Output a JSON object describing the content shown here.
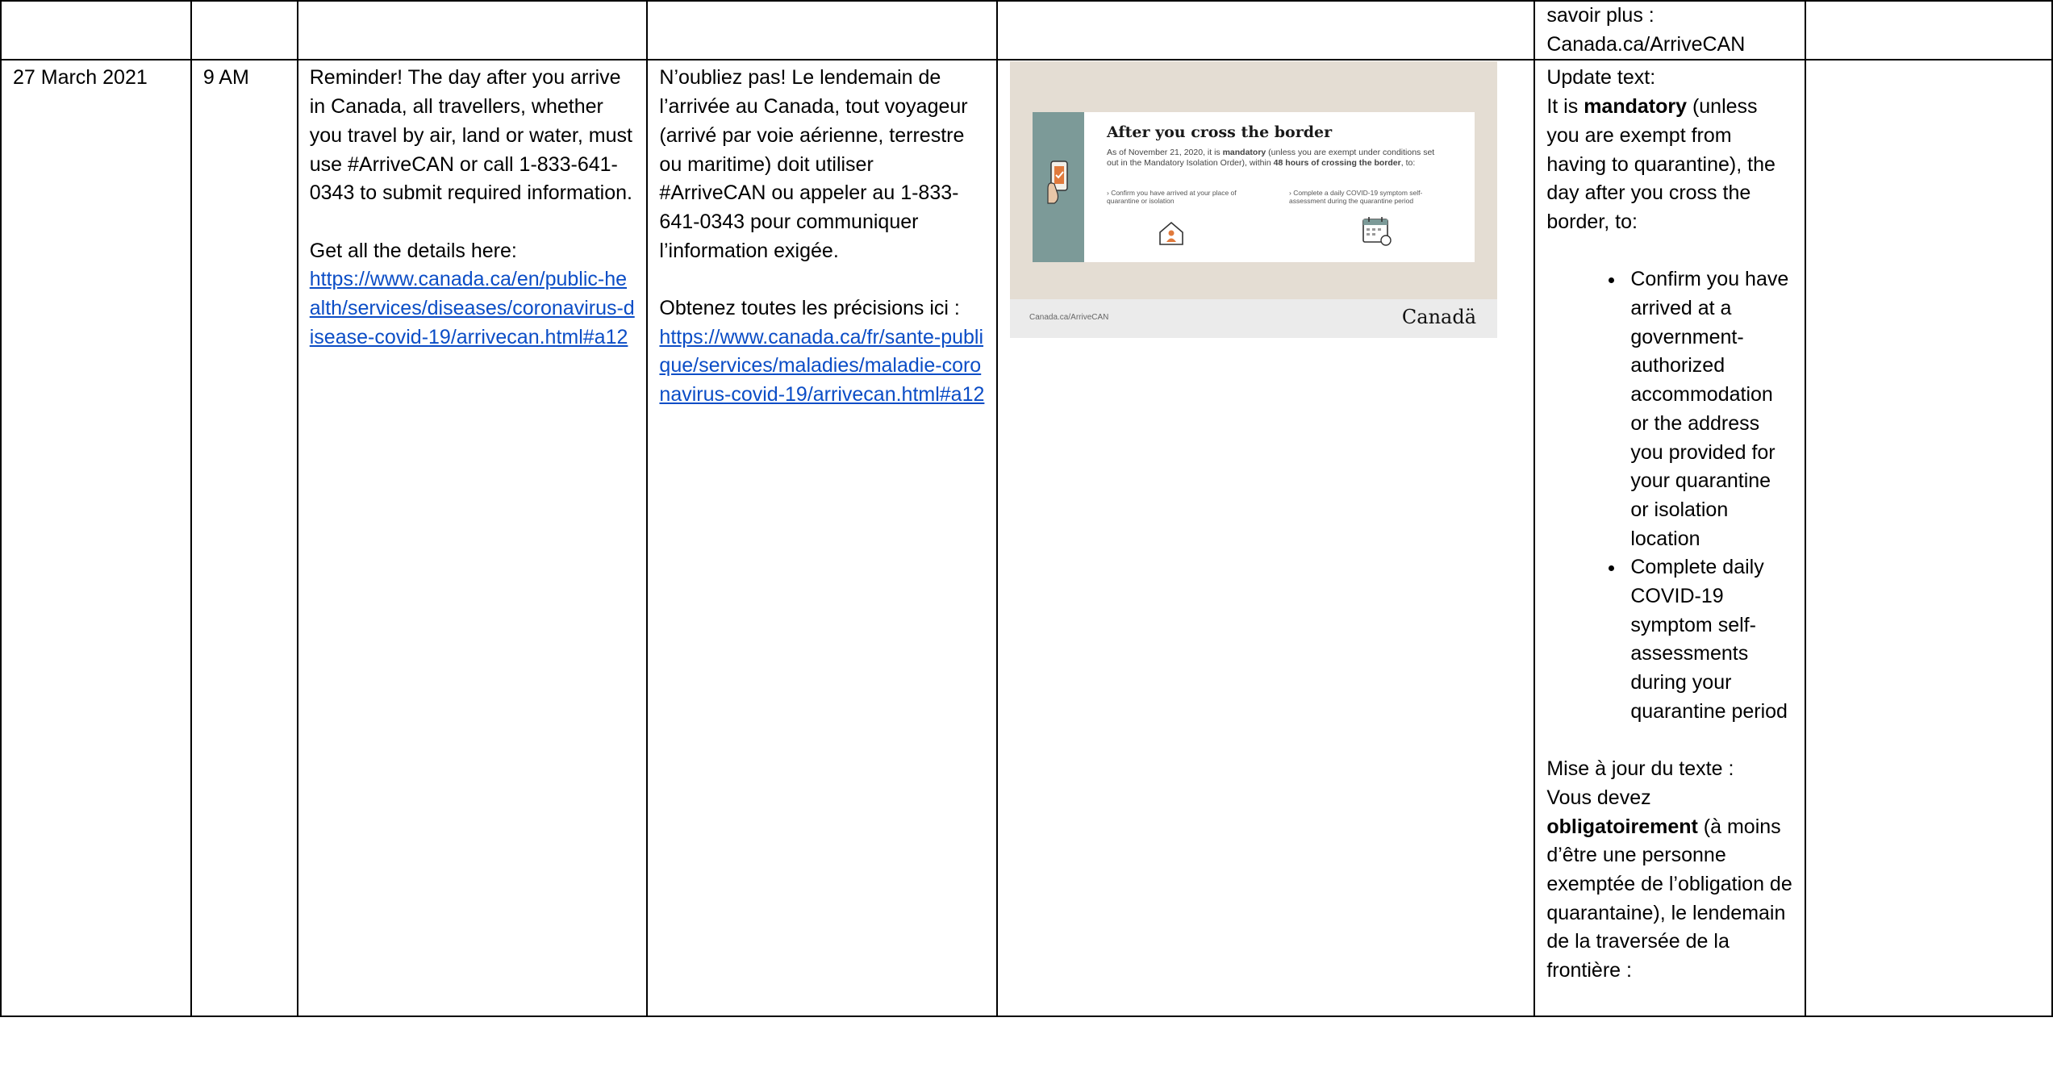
{
  "row0": {
    "col6": "savoir plus : Canada.ca/ArriveCAN"
  },
  "row1": {
    "date": "27 March 2021",
    "time": "9 AM",
    "english": {
      "body": "Reminder! The day after you arrive in Canada, all travellers, whether you travel by air, land or water, must use #ArriveCAN or call 1-833-641-0343 to submit required information.",
      "details_label": "Get all the details here:",
      "link": "https://www.canada.ca/en/public-health/services/diseases/coronavirus-disease-covid-19/arrivecan.html#a12"
    },
    "french": {
      "body": "N’oubliez pas! Le lendemain de l’arrivée au Canada, tout voyageur (arrivé par voie aérienne, terrestre ou maritime) doit utiliser #ArriveCAN ou appeler au 1-833-641-0343 pour communiquer l’information exigée.",
      "details_label": "Obtenez toutes les précisions ici :",
      "link": "https://www.canada.ca/fr/sante-publique/services/maladies/maladie-coronavirus-covid-19/arrivecan.html#a12"
    },
    "image": {
      "title": "After you cross the border",
      "body_pre": "As of November 21, 2020, it is ",
      "body_bold1": "mandatory",
      "body_mid": " (unless you are exempt under conditions set out in the Mandatory Isolation Order), within ",
      "body_bold2": "48 hours of crossing the border",
      "body_post": ", to:",
      "item1": "› Confirm you have arrived at your place of quarantine or isolation",
      "item2": "› Complete a daily COVID-19 symptom self-assessment during the quarantine period",
      "footer_url": "Canada.ca/ArriveCAN",
      "footer_brand": "Canadä",
      "bg_color": "#e4ddd3",
      "accent_color": "#7c9a98"
    },
    "update": {
      "heading": "Update text:",
      "pre": "It is ",
      "bold": "mandatory",
      "post": " (unless you are exempt from having to quarantine), the day after you cross the border, to:",
      "bullets": [
        "Confirm you have arrived at a government-authorized accommodation or the address you provided for your quarantine or isolation location",
        "Complete daily COVID-19 symptom self-assessments during your quarantine period"
      ],
      "fr_heading": "Mise à jour du texte :",
      "fr_pre": "Vous devez ",
      "fr_bold": "obligatoirement",
      "fr_post": " (à moins d’être une personne exemptée de l’obligation de quarantaine), le lendemain de la traversée de la frontière :"
    }
  },
  "colors": {
    "link": "#0b4dc6",
    "border": "#000000"
  }
}
